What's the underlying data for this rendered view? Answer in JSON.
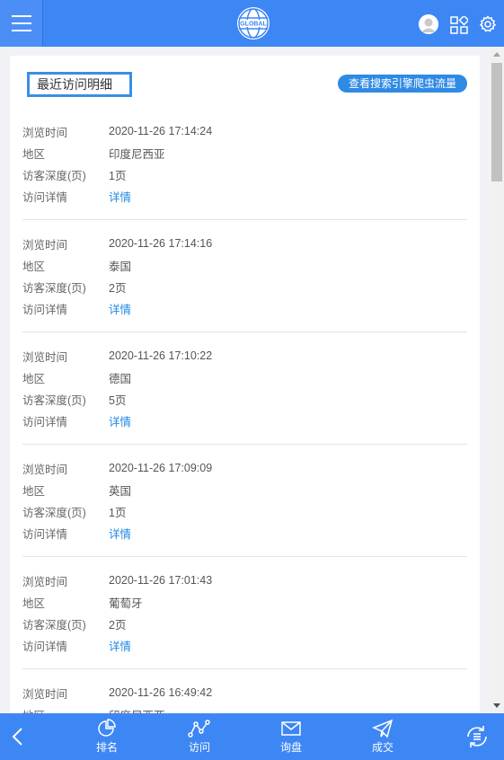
{
  "header": {
    "logo_text": "GLOBAL",
    "icons": [
      "menu-icon",
      "globe-logo",
      "avatar",
      "apps-icon",
      "gear-icon"
    ]
  },
  "main": {
    "title": "最近访问明细",
    "crawler_button": "查看搜索引擎爬虫流量",
    "labels": {
      "time": "浏览时间",
      "region": "地区",
      "depth": "访客深度(页)",
      "detail": "访问详情"
    },
    "records": [
      {
        "time": "2020-11-26 17:14:24",
        "region": "印度尼西亚",
        "depth": "1页",
        "detail": "详情"
      },
      {
        "time": "2020-11-26 17:14:16",
        "region": "泰国",
        "depth": "2页",
        "detail": "详情"
      },
      {
        "time": "2020-11-26 17:10:22",
        "region": "德国",
        "depth": "5页",
        "detail": "详情"
      },
      {
        "time": "2020-11-26 17:09:09",
        "region": "英国",
        "depth": "1页",
        "detail": "详情"
      },
      {
        "time": "2020-11-26 17:01:43",
        "region": "葡萄牙",
        "depth": "2页",
        "detail": "详情"
      },
      {
        "time": "2020-11-26 16:49:42",
        "region": "印度尼西亚",
        "depth": "",
        "detail": ""
      }
    ]
  },
  "bottom_nav": {
    "items": [
      {
        "label": "排名",
        "icon": "pie-chart-icon"
      },
      {
        "label": "访问",
        "icon": "line-chart-icon"
      },
      {
        "label": "询盘",
        "icon": "mail-icon"
      },
      {
        "label": "成交",
        "icon": "paper-plane-icon"
      }
    ]
  },
  "colors": {
    "primary": "#3d87f5",
    "link": "#1e88e5",
    "title_border": "#3a8ee6"
  }
}
